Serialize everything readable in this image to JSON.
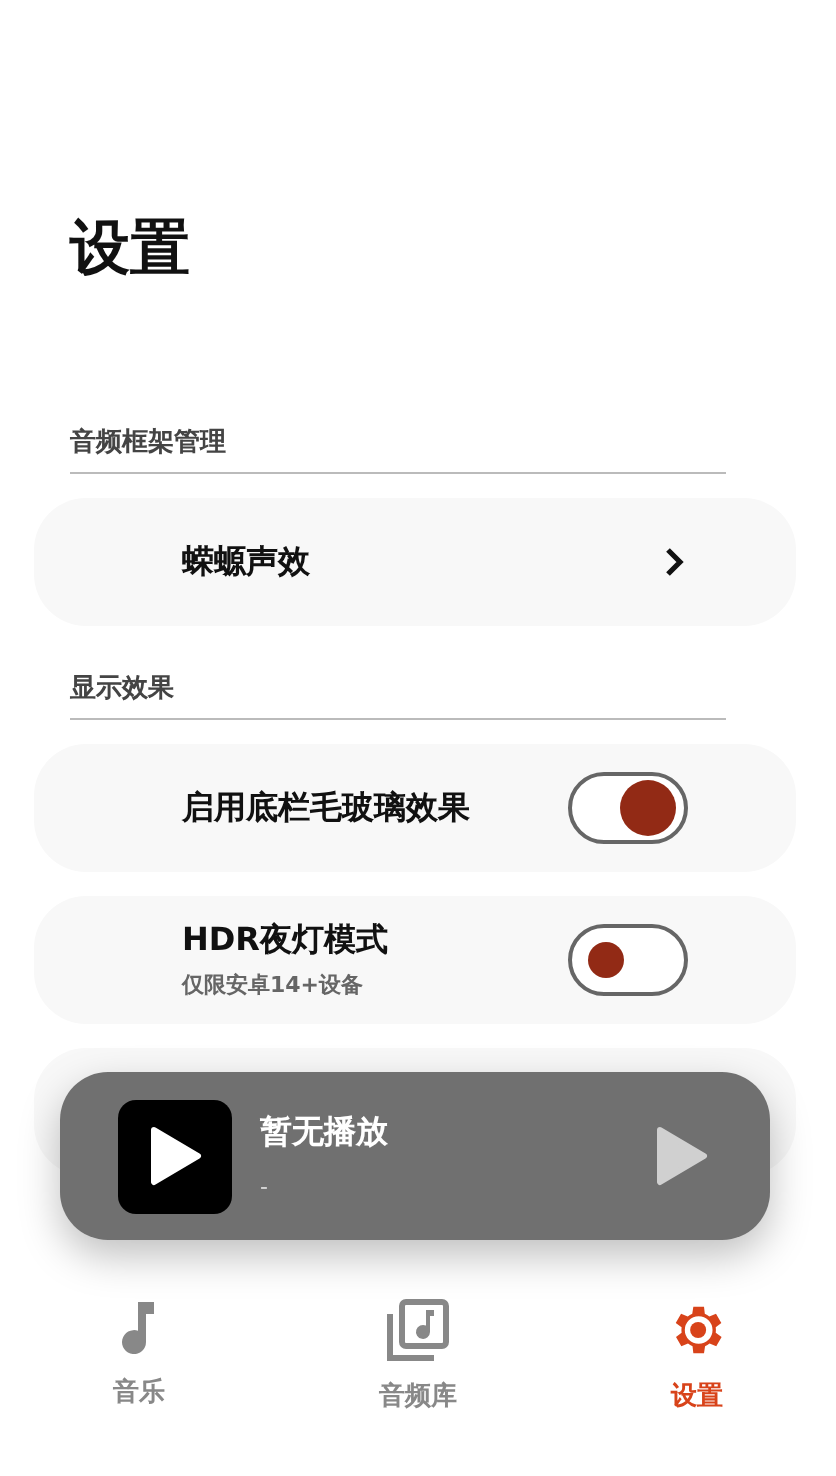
{
  "title": "设置",
  "sections": [
    {
      "header": "音频框架管理",
      "items": [
        {
          "kind": "link",
          "label": "蝾螈声效"
        }
      ]
    },
    {
      "header": "显示效果",
      "items": [
        {
          "kind": "toggle",
          "label": "启用底栏毛玻璃效果",
          "on": true
        },
        {
          "kind": "toggle",
          "label": "HDR夜灯模式",
          "subtitle": "仅限安卓14+设备",
          "on": false
        }
      ]
    }
  ],
  "player": {
    "title": "暂无播放",
    "subtitle": "-"
  },
  "nav": [
    {
      "label": "音乐",
      "kind": "note",
      "selected": false
    },
    {
      "label": "音频库",
      "kind": "library",
      "selected": false
    },
    {
      "label": "设置",
      "kind": "gear",
      "selected": true
    }
  ]
}
